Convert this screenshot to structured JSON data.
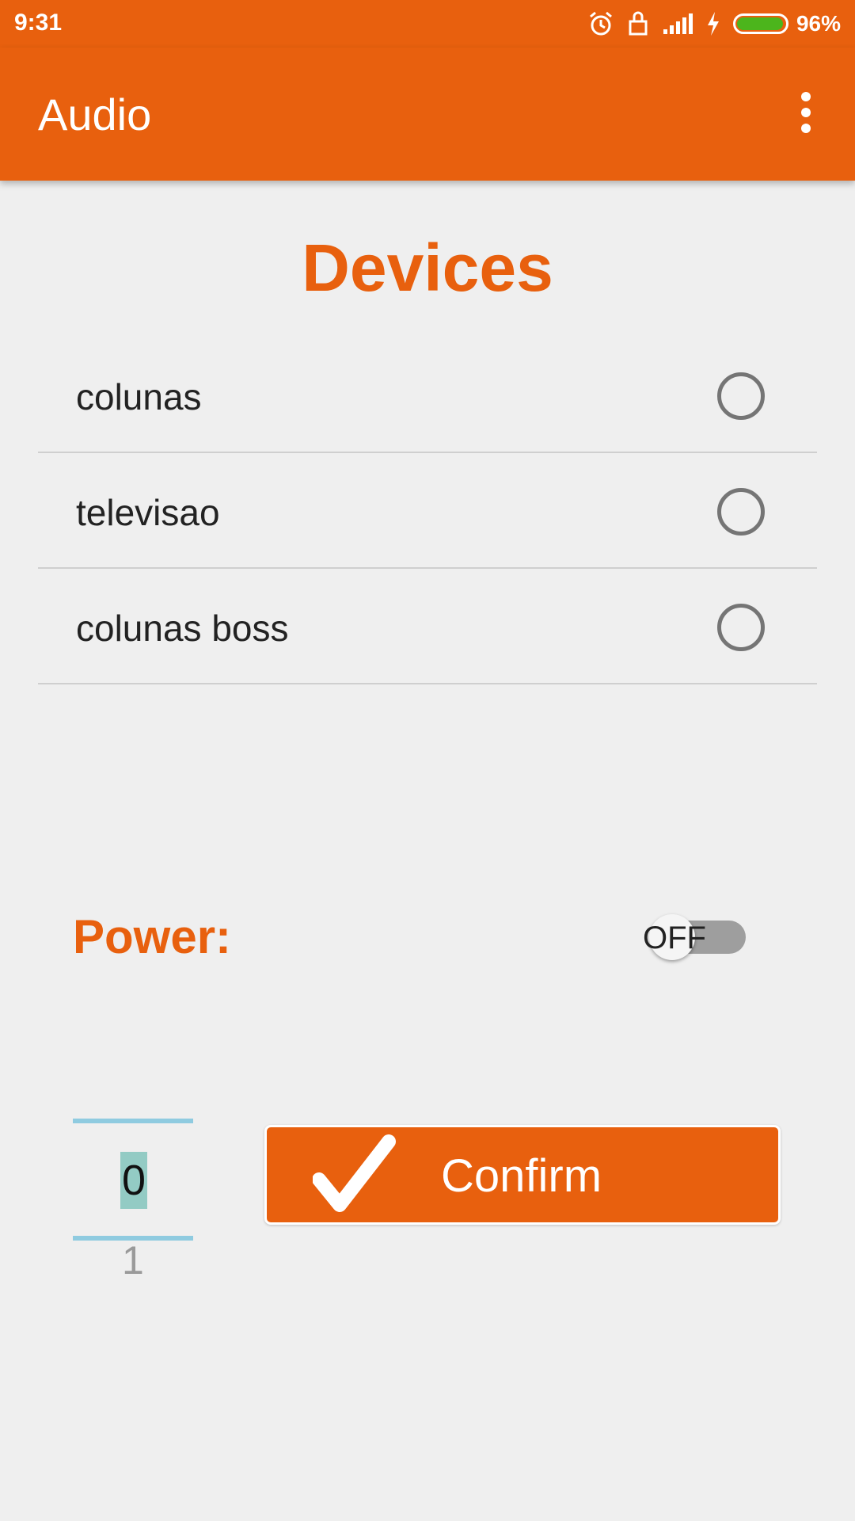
{
  "status_bar": {
    "time": "9:31",
    "icons": [
      "alarm-icon",
      "lock-icon",
      "signal-icon",
      "charging-icon",
      "battery-icon"
    ],
    "battery_percent": "96%",
    "battery_level": 0.96,
    "battery_color": "#4cb51c"
  },
  "app_bar": {
    "title": "Audio",
    "menu_icon": "more-vert-icon",
    "color": "#e8600e"
  },
  "devices": {
    "title": "Devices",
    "items": [
      {
        "label": "colunas",
        "selected": false
      },
      {
        "label": "televisao",
        "selected": false
      },
      {
        "label": "colunas boss",
        "selected": false
      }
    ]
  },
  "power": {
    "label": "Power:",
    "toggle_text": "OFF",
    "on": false
  },
  "number_picker": {
    "current": "0",
    "next": "1"
  },
  "confirm": {
    "label": "Confirm",
    "icon": "checkmark-icon"
  }
}
